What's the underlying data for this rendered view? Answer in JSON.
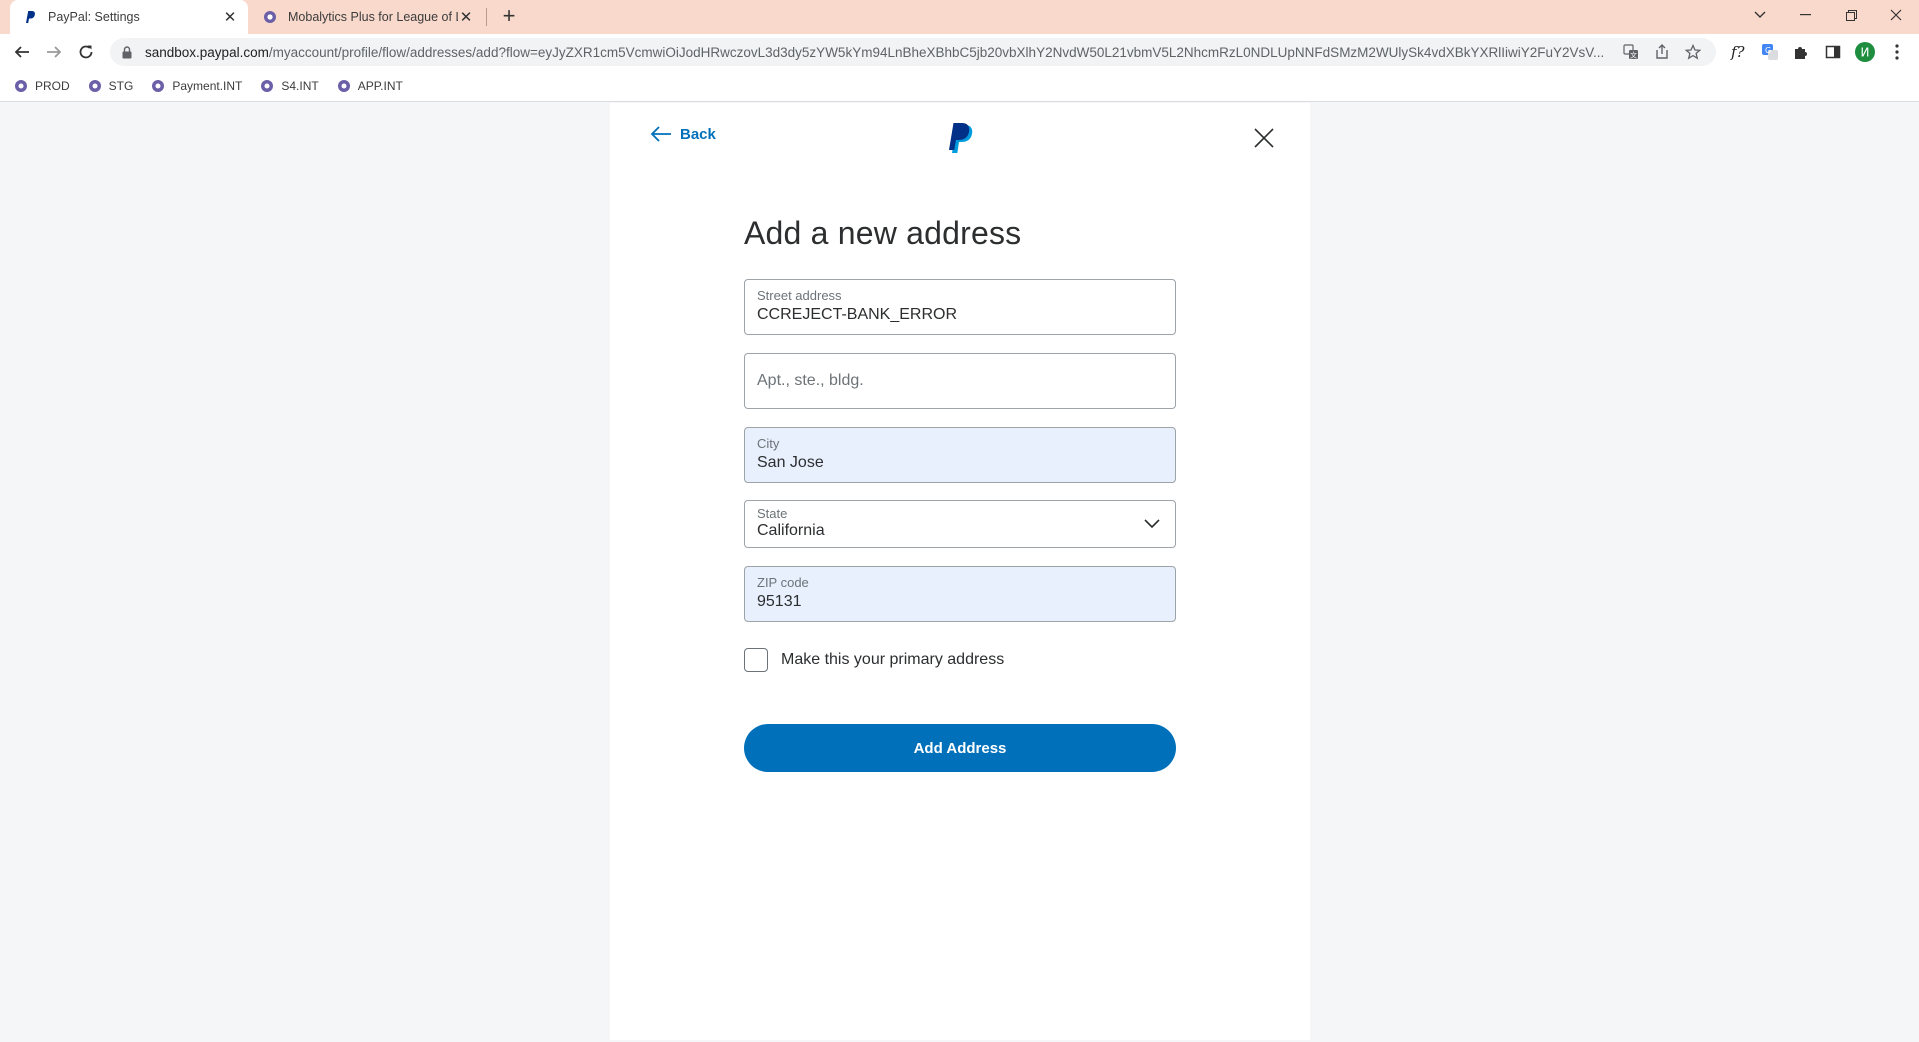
{
  "browser": {
    "tabs": [
      {
        "title": "PayPal: Settings",
        "active": true
      },
      {
        "title": "Mobalytics Plus for League of Le",
        "active": false
      }
    ],
    "url": {
      "host": "sandbox.paypal.com",
      "path": "/myaccount/profile/flow/addresses/add?flow=eyJyZXR1cm5VcmwiOiJodHRwczovL3d3dy5zYW5kYm94LnBheXBhbC5jb20vbXlhY2NvdW50L21vbmV5L2NhcmRzL0NDLUpNNFdSMzM2WUlySk4vdXBkYXRlIiwiY2FuY2VsV..."
    },
    "bookmarks": [
      "PROD",
      "STG",
      "Payment.INT",
      "S4.INT",
      "APP.INT"
    ]
  },
  "page": {
    "back_label": "Back",
    "heading": "Add a new address",
    "street": {
      "label": "Street address",
      "value": "CCREJECT-BANK_ERROR"
    },
    "apt": {
      "placeholder": "Apt., ste., bldg."
    },
    "city": {
      "label": "City",
      "value": "San Jose"
    },
    "state": {
      "label": "State",
      "value": "California"
    },
    "zip": {
      "label": "ZIP code",
      "value": "95131"
    },
    "primary_checkbox": {
      "label": "Make this your primary address",
      "checked": false
    },
    "submit_label": "Add Address"
  },
  "colors": {
    "accent": "#0070ba",
    "autofill": "#e8f0fe",
    "tabbar": "#f9d9cc"
  }
}
